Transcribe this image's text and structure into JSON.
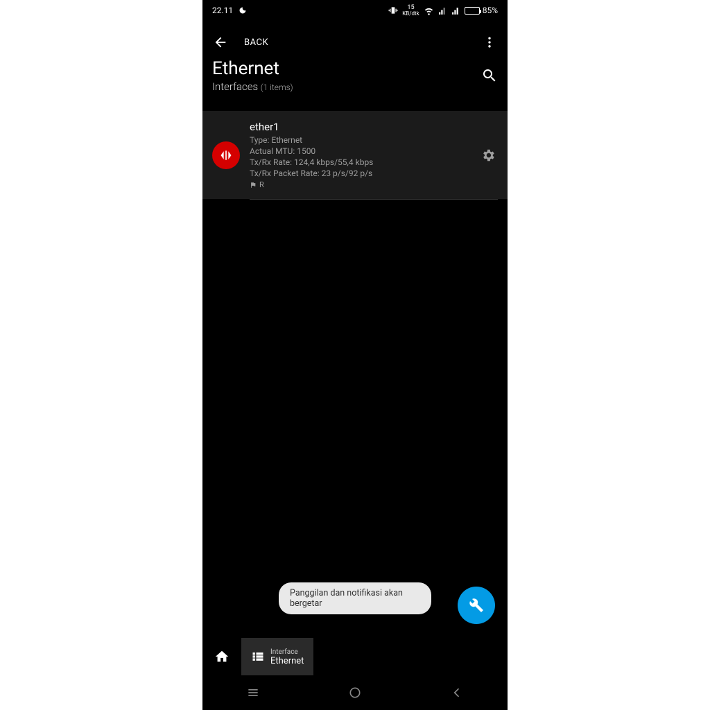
{
  "status": {
    "time": "22.11",
    "net_rate_num": "15",
    "net_rate_unit": "KB/dtk",
    "battery_pct": "85%"
  },
  "header": {
    "back_label": "BACK",
    "title": "Ethernet",
    "subtitle": "Interfaces",
    "count_label": "(1 items)"
  },
  "item": {
    "name": "ether1",
    "type_line": "Type: Ethernet",
    "mtu_line": "Actual MTU: 1500",
    "rate_line": "Tx/Rx Rate: 124,4 kbps/55,4 kbps",
    "pkt_line": "Tx/Rx Packet Rate: 23 p/s/92 p/s",
    "flag": "R"
  },
  "toast": {
    "text": "Panggilan dan notifikasi akan bergetar"
  },
  "tabs": {
    "interface_top": "Interface",
    "interface_bottom": "Ethernet"
  },
  "colors": {
    "accent": "#039be5",
    "avatar": "#d50000"
  }
}
